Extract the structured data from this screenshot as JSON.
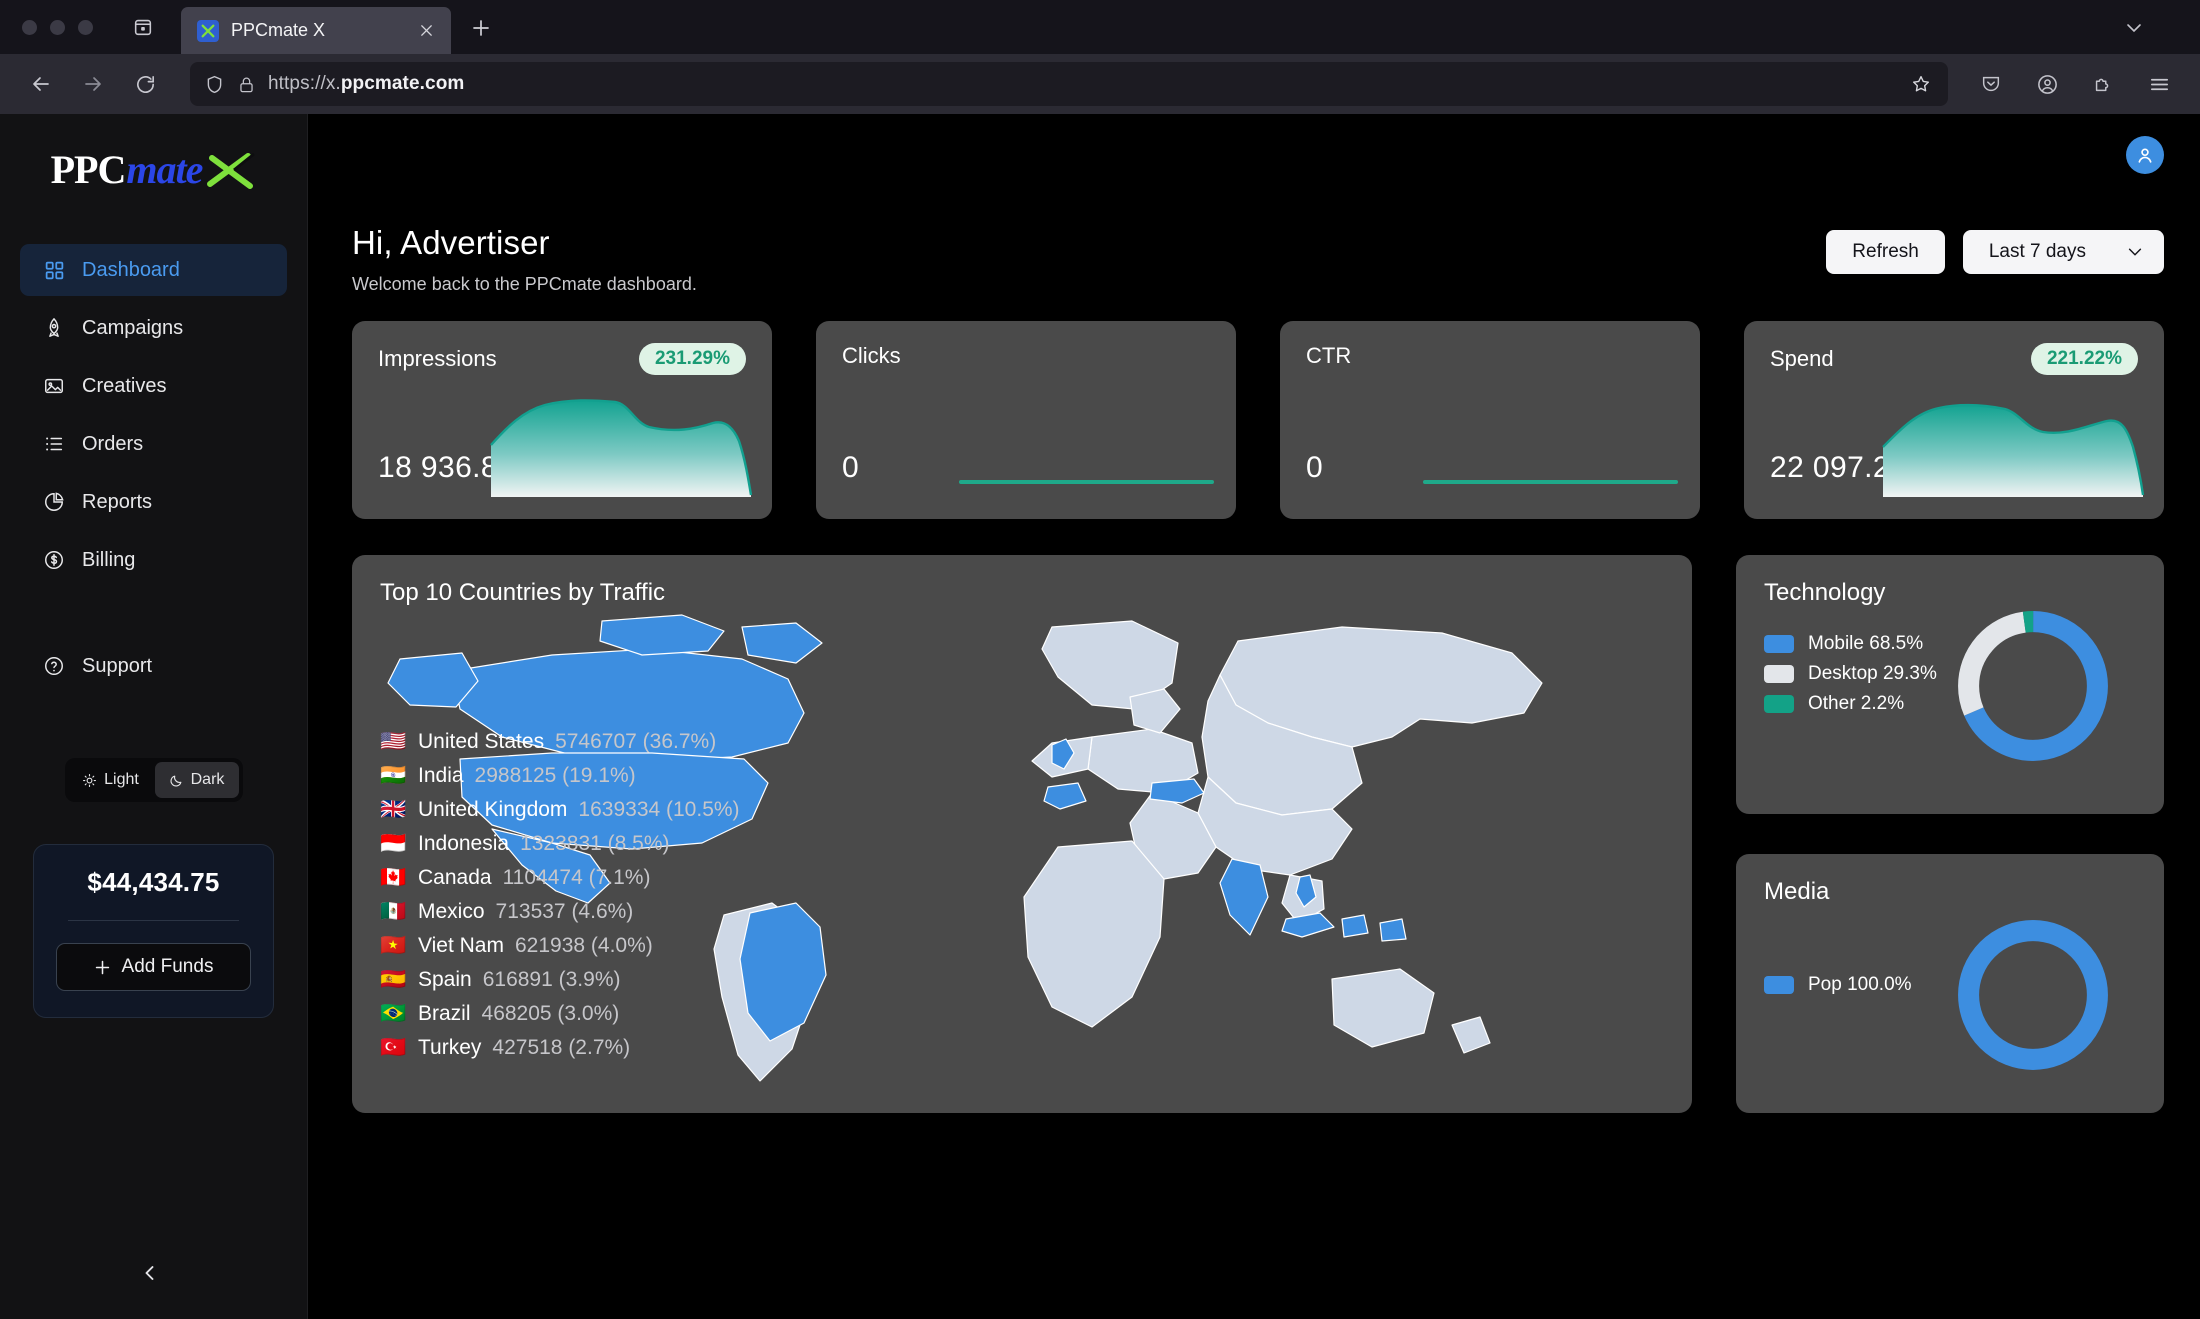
{
  "browser": {
    "tab_title": "PPCmate X",
    "url_prefix": "https://x.",
    "url_bold": "ppcmate.com",
    "back_icon": "back-arrow-icon",
    "forward_icon": "forward-arrow-icon",
    "reload_icon": "reload-icon",
    "shield_icon": "shield-icon",
    "lock_icon": "lock-icon",
    "star_icon": "star-icon",
    "pocket_icon": "pocket-icon",
    "account_icon": "account-icon",
    "extensions_icon": "extensions-icon",
    "menu_icon": "hamburger-menu-icon",
    "new_tab_icon": "plus-icon",
    "close_tab_icon": "close-icon",
    "list_tabs_icon": "list-all-tabs-icon",
    "chevron_icon": "chevron-down-icon"
  },
  "sidebar": {
    "logo": {
      "part1": "PPC",
      "part2": "mate",
      "mark": "x-mark-logo"
    },
    "items": [
      {
        "label": "Dashboard",
        "icon": "grid-icon",
        "active": true
      },
      {
        "label": "Campaigns",
        "icon": "rocket-icon",
        "active": false
      },
      {
        "label": "Creatives",
        "icon": "image-icon",
        "active": false
      },
      {
        "label": "Orders",
        "icon": "list-icon",
        "active": false
      },
      {
        "label": "Reports",
        "icon": "pie-chart-icon",
        "active": false
      },
      {
        "label": "Billing",
        "icon": "dollar-circle-icon",
        "active": false
      }
    ],
    "support": {
      "label": "Support",
      "icon": "question-circle-icon"
    },
    "theme": {
      "light_label": "Light",
      "dark_label": "Dark",
      "selected": "Dark",
      "light_icon": "sun-icon",
      "dark_icon": "moon-icon"
    },
    "balance": {
      "amount": "$44,434.75",
      "add_funds_label": "Add Funds",
      "add_icon": "plus-icon"
    },
    "collapse_icon": "chevron-left-icon"
  },
  "header": {
    "title": "Hi, Advertiser",
    "subtitle": "Welcome back to the PPCmate dashboard.",
    "refresh_label": "Refresh",
    "range_label": "Last 7 days",
    "range_chevron": "chevron-down-icon",
    "avatar_icon": "user-avatar-icon"
  },
  "kpis": [
    {
      "label": "Impressions",
      "value": "18 936.82k",
      "badge": "231.29%",
      "chart": "area"
    },
    {
      "label": "Clicks",
      "value": "0",
      "badge": "",
      "chart": "flat"
    },
    {
      "label": "CTR",
      "value": "0",
      "badge": "",
      "chart": "flat"
    },
    {
      "label": "Spend",
      "value": "22 097.24",
      "badge": "221.22%",
      "chart": "area"
    }
  ],
  "map_panel": {
    "title": "Top 10 Countries by Traffic",
    "countries": [
      {
        "flag": "🇺🇸",
        "name": "United States",
        "stat": "5746707 (36.7%)"
      },
      {
        "flag": "🇮🇳",
        "name": "India",
        "stat": "2988125 (19.1%)"
      },
      {
        "flag": "🇬🇧",
        "name": "United Kingdom",
        "stat": "1639334 (10.5%)"
      },
      {
        "flag": "🇮🇩",
        "name": "Indonesia",
        "stat": "1323831 (8.5%)"
      },
      {
        "flag": "🇨🇦",
        "name": "Canada",
        "stat": "1104474 (7.1%)"
      },
      {
        "flag": "🇲🇽",
        "name": "Mexico",
        "stat": "713537 (4.6%)"
      },
      {
        "flag": "🇻🇳",
        "name": "Viet Nam",
        "stat": "621938 (4.0%)"
      },
      {
        "flag": "🇪🇸",
        "name": "Spain",
        "stat": "616891 (3.9%)"
      },
      {
        "flag": "🇧🇷",
        "name": "Brazil",
        "stat": "468205 (3.0%)"
      },
      {
        "flag": "🇹🇷",
        "name": "Turkey",
        "stat": "427518 (2.7%)"
      }
    ]
  },
  "technology": {
    "title": "Technology",
    "legend": [
      {
        "label": "Mobile 68.5%",
        "color": "#3d8ee0"
      },
      {
        "label": "Desktop 29.3%",
        "color": "#e3e6ea"
      },
      {
        "label": "Other 2.2%",
        "color": "#13a287"
      }
    ]
  },
  "media": {
    "title": "Media",
    "legend": [
      {
        "label": "Pop 100.0%",
        "color": "#3d8ee0"
      }
    ]
  },
  "chart_data": [
    {
      "type": "area",
      "title": "Impressions",
      "name": "impressions-sparkline",
      "x": [
        0,
        1,
        2,
        3,
        4,
        5,
        6,
        7,
        8,
        9,
        10,
        11
      ],
      "values": [
        52,
        78,
        88,
        89,
        88,
        72,
        70,
        70,
        72,
        76,
        70,
        4
      ],
      "ylim": [
        0,
        100
      ],
      "color": "#16a391"
    },
    {
      "type": "line",
      "title": "Clicks",
      "name": "clicks-sparkline",
      "x": [
        0,
        1
      ],
      "values": [
        0,
        0
      ],
      "ylim": [
        0,
        1
      ],
      "color": "#1fa98a"
    },
    {
      "type": "line",
      "title": "CTR",
      "name": "ctr-sparkline",
      "x": [
        0,
        1
      ],
      "values": [
        0,
        0
      ],
      "ylim": [
        0,
        1
      ],
      "color": "#1fa98a"
    },
    {
      "type": "area",
      "title": "Spend",
      "name": "spend-sparkline",
      "x": [
        0,
        1,
        2,
        3,
        4,
        5,
        6,
        7,
        8,
        9,
        10,
        11
      ],
      "values": [
        50,
        76,
        86,
        86,
        82,
        66,
        64,
        66,
        72,
        76,
        68,
        2
      ],
      "ylim": [
        0,
        100
      ],
      "color": "#16a391"
    },
    {
      "type": "pie",
      "title": "Technology",
      "name": "technology-donut",
      "labels": [
        "Mobile",
        "Desktop",
        "Other"
      ],
      "values": [
        68.5,
        29.3,
        2.2
      ],
      "colors": [
        "#3d8ee0",
        "#e3e6ea",
        "#13a287"
      ],
      "legend_position": "left"
    },
    {
      "type": "pie",
      "title": "Media",
      "name": "media-donut",
      "labels": [
        "Pop"
      ],
      "values": [
        100.0
      ],
      "colors": [
        "#3d8ee0"
      ],
      "legend_position": "left"
    },
    {
      "type": "heatmap",
      "title": "Top 10 Countries by Traffic",
      "name": "world-traffic-choropleth",
      "categories": [
        "United States",
        "India",
        "United Kingdom",
        "Indonesia",
        "Canada",
        "Mexico",
        "Viet Nam",
        "Spain",
        "Brazil",
        "Turkey"
      ],
      "values": [
        5746707,
        2988125,
        1639334,
        1323831,
        1104474,
        713537,
        621938,
        616891,
        468205,
        427518
      ],
      "percents": [
        36.7,
        19.1,
        10.5,
        8.5,
        7.1,
        4.6,
        4.0,
        3.9,
        3.0,
        2.7
      ],
      "highlight_color": "#3d8ee0",
      "base_color": "#ced8e6"
    }
  ]
}
